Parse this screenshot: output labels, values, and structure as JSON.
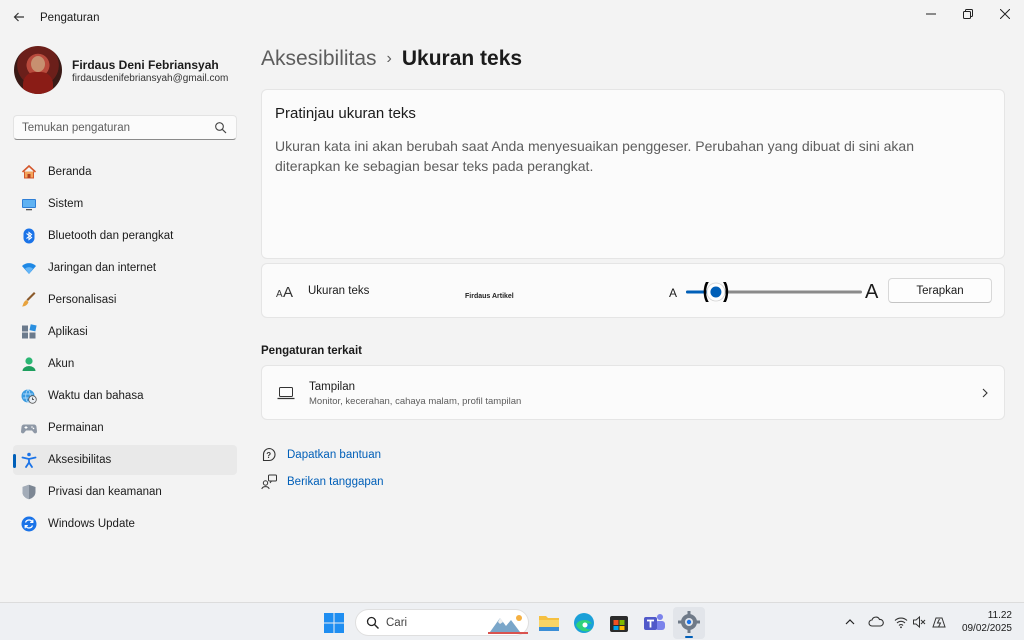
{
  "window": {
    "title": "Pengaturan"
  },
  "profile": {
    "name": "Firdaus Deni Febriansyah",
    "email": "firdausdenifebriansyah@gmail.com"
  },
  "search": {
    "placeholder": "Temukan pengaturan"
  },
  "sidebar": {
    "items": [
      {
        "label": "Beranda",
        "icon": "home-icon"
      },
      {
        "label": "Sistem",
        "icon": "system-icon"
      },
      {
        "label": "Bluetooth dan perangkat",
        "icon": "bluetooth-icon"
      },
      {
        "label": "Jaringan dan internet",
        "icon": "wifi-icon"
      },
      {
        "label": "Personalisasi",
        "icon": "brush-icon"
      },
      {
        "label": "Aplikasi",
        "icon": "apps-icon"
      },
      {
        "label": "Akun",
        "icon": "account-icon"
      },
      {
        "label": "Waktu dan bahasa",
        "icon": "globe-clock-icon"
      },
      {
        "label": "Permainan",
        "icon": "gamepad-icon"
      },
      {
        "label": "Aksesibilitas",
        "icon": "accessibility-icon",
        "active": true
      },
      {
        "label": "Privasi dan keamanan",
        "icon": "shield-icon"
      },
      {
        "label": "Windows Update",
        "icon": "update-icon"
      }
    ]
  },
  "breadcrumb": {
    "parent": "Aksesibilitas",
    "separator": "›",
    "current": "Ukuran teks"
  },
  "preview": {
    "title": "Pratinjau ukuran teks",
    "text": "Ukuran kata ini akan berubah saat Anda menyesuaikan penggeser. Perubahan yang dibuat di sini akan diterapkan ke sebagian besar teks pada perangkat."
  },
  "text_size": {
    "label": "Ukuran teks",
    "watermark": "Firdaus Artikel",
    "small_marker": "A",
    "large_marker": "A",
    "slider_fraction": 0.17,
    "apply_label": "Terapkan"
  },
  "related": {
    "heading": "Pengaturan terkait",
    "display_title": "Tampilan",
    "display_subtitle": "Monitor, kecerahan, cahaya malam, profil tampilan"
  },
  "help": {
    "get_help": "Dapatkan bantuan",
    "give_feedback": "Berikan tanggapan"
  },
  "taskbar": {
    "search_label": "Cari",
    "time": "11.22",
    "date": "09/02/2025"
  },
  "colors": {
    "accent": "#005fb8",
    "background": "#f3f3f3",
    "card": "#fbfbfb"
  }
}
